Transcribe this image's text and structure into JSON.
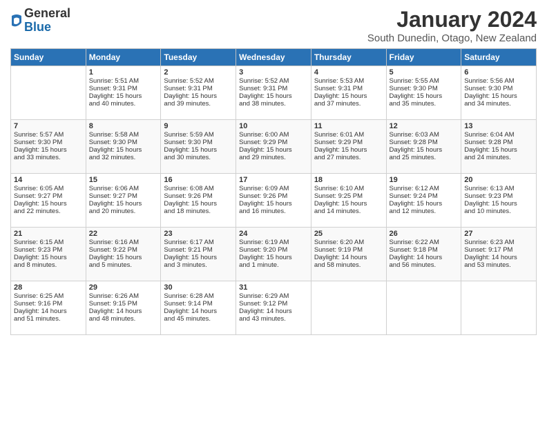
{
  "logo": {
    "general": "General",
    "blue": "Blue"
  },
  "header": {
    "month": "January 2024",
    "location": "South Dunedin, Otago, New Zealand"
  },
  "days_of_week": [
    "Sunday",
    "Monday",
    "Tuesday",
    "Wednesday",
    "Thursday",
    "Friday",
    "Saturday"
  ],
  "weeks": [
    [
      {
        "day": "",
        "content": ""
      },
      {
        "day": "1",
        "content": "Sunrise: 5:51 AM\nSunset: 9:31 PM\nDaylight: 15 hours\nand 40 minutes."
      },
      {
        "day": "2",
        "content": "Sunrise: 5:52 AM\nSunset: 9:31 PM\nDaylight: 15 hours\nand 39 minutes."
      },
      {
        "day": "3",
        "content": "Sunrise: 5:52 AM\nSunset: 9:31 PM\nDaylight: 15 hours\nand 38 minutes."
      },
      {
        "day": "4",
        "content": "Sunrise: 5:53 AM\nSunset: 9:31 PM\nDaylight: 15 hours\nand 37 minutes."
      },
      {
        "day": "5",
        "content": "Sunrise: 5:55 AM\nSunset: 9:30 PM\nDaylight: 15 hours\nand 35 minutes."
      },
      {
        "day": "6",
        "content": "Sunrise: 5:56 AM\nSunset: 9:30 PM\nDaylight: 15 hours\nand 34 minutes."
      }
    ],
    [
      {
        "day": "7",
        "content": "Sunrise: 5:57 AM\nSunset: 9:30 PM\nDaylight: 15 hours\nand 33 minutes."
      },
      {
        "day": "8",
        "content": "Sunrise: 5:58 AM\nSunset: 9:30 PM\nDaylight: 15 hours\nand 32 minutes."
      },
      {
        "day": "9",
        "content": "Sunrise: 5:59 AM\nSunset: 9:30 PM\nDaylight: 15 hours\nand 30 minutes."
      },
      {
        "day": "10",
        "content": "Sunrise: 6:00 AM\nSunset: 9:29 PM\nDaylight: 15 hours\nand 29 minutes."
      },
      {
        "day": "11",
        "content": "Sunrise: 6:01 AM\nSunset: 9:29 PM\nDaylight: 15 hours\nand 27 minutes."
      },
      {
        "day": "12",
        "content": "Sunrise: 6:03 AM\nSunset: 9:28 PM\nDaylight: 15 hours\nand 25 minutes."
      },
      {
        "day": "13",
        "content": "Sunrise: 6:04 AM\nSunset: 9:28 PM\nDaylight: 15 hours\nand 24 minutes."
      }
    ],
    [
      {
        "day": "14",
        "content": "Sunrise: 6:05 AM\nSunset: 9:27 PM\nDaylight: 15 hours\nand 22 minutes."
      },
      {
        "day": "15",
        "content": "Sunrise: 6:06 AM\nSunset: 9:27 PM\nDaylight: 15 hours\nand 20 minutes."
      },
      {
        "day": "16",
        "content": "Sunrise: 6:08 AM\nSunset: 9:26 PM\nDaylight: 15 hours\nand 18 minutes."
      },
      {
        "day": "17",
        "content": "Sunrise: 6:09 AM\nSunset: 9:26 PM\nDaylight: 15 hours\nand 16 minutes."
      },
      {
        "day": "18",
        "content": "Sunrise: 6:10 AM\nSunset: 9:25 PM\nDaylight: 15 hours\nand 14 minutes."
      },
      {
        "day": "19",
        "content": "Sunrise: 6:12 AM\nSunset: 9:24 PM\nDaylight: 15 hours\nand 12 minutes."
      },
      {
        "day": "20",
        "content": "Sunrise: 6:13 AM\nSunset: 9:23 PM\nDaylight: 15 hours\nand 10 minutes."
      }
    ],
    [
      {
        "day": "21",
        "content": "Sunrise: 6:15 AM\nSunset: 9:23 PM\nDaylight: 15 hours\nand 8 minutes."
      },
      {
        "day": "22",
        "content": "Sunrise: 6:16 AM\nSunset: 9:22 PM\nDaylight: 15 hours\nand 5 minutes."
      },
      {
        "day": "23",
        "content": "Sunrise: 6:17 AM\nSunset: 9:21 PM\nDaylight: 15 hours\nand 3 minutes."
      },
      {
        "day": "24",
        "content": "Sunrise: 6:19 AM\nSunset: 9:20 PM\nDaylight: 15 hours\nand 1 minute."
      },
      {
        "day": "25",
        "content": "Sunrise: 6:20 AM\nSunset: 9:19 PM\nDaylight: 14 hours\nand 58 minutes."
      },
      {
        "day": "26",
        "content": "Sunrise: 6:22 AM\nSunset: 9:18 PM\nDaylight: 14 hours\nand 56 minutes."
      },
      {
        "day": "27",
        "content": "Sunrise: 6:23 AM\nSunset: 9:17 PM\nDaylight: 14 hours\nand 53 minutes."
      }
    ],
    [
      {
        "day": "28",
        "content": "Sunrise: 6:25 AM\nSunset: 9:16 PM\nDaylight: 14 hours\nand 51 minutes."
      },
      {
        "day": "29",
        "content": "Sunrise: 6:26 AM\nSunset: 9:15 PM\nDaylight: 14 hours\nand 48 minutes."
      },
      {
        "day": "30",
        "content": "Sunrise: 6:28 AM\nSunset: 9:14 PM\nDaylight: 14 hours\nand 45 minutes."
      },
      {
        "day": "31",
        "content": "Sunrise: 6:29 AM\nSunset: 9:12 PM\nDaylight: 14 hours\nand 43 minutes."
      },
      {
        "day": "",
        "content": ""
      },
      {
        "day": "",
        "content": ""
      },
      {
        "day": "",
        "content": ""
      }
    ]
  ]
}
